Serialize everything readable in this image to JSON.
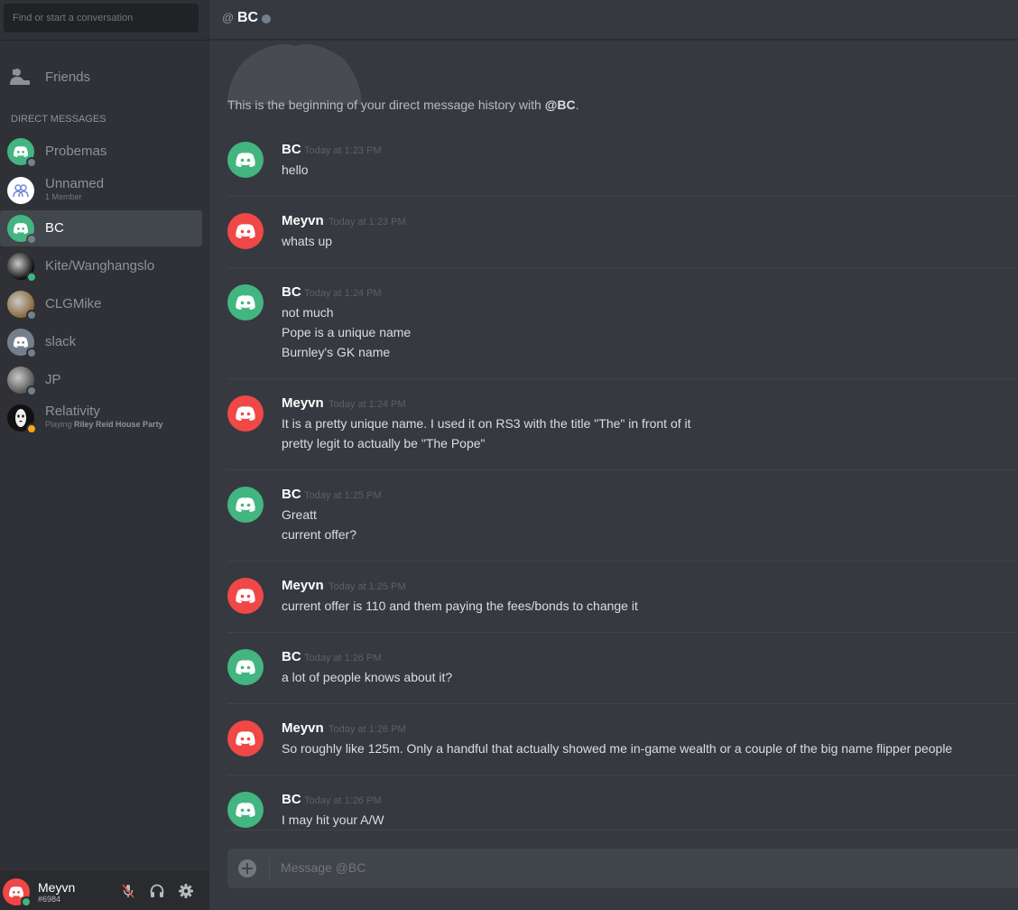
{
  "colors": {
    "sidebar_bg": "#2f3136",
    "main_bg": "#36393f",
    "discord_green": "#43b581",
    "discord_red": "#f04747",
    "discord_gray": "#747f8d",
    "status_online": "#43b581",
    "status_idle": "#faa61a",
    "status_offline": "#747f8d"
  },
  "search": {
    "placeholder": "Find or start a conversation"
  },
  "sidebar": {
    "friends_label": "Friends",
    "dm_header": "DIRECT MESSAGES",
    "dms": [
      {
        "name": "Probemas",
        "sub": "",
        "avatar": "discord-green",
        "status": "offline"
      },
      {
        "name": "Unnamed",
        "sub": "1 Member",
        "avatar": "group",
        "status": ""
      },
      {
        "name": "BC",
        "sub": "",
        "avatar": "discord-green",
        "status": "offline",
        "active": true
      },
      {
        "name": "Kite/Wanghangslo",
        "sub": "",
        "avatar": "photo",
        "status": "online"
      },
      {
        "name": "CLGMike",
        "sub": "",
        "avatar": "photo",
        "status": "offline"
      },
      {
        "name": "slack",
        "sub": "",
        "avatar": "discord-gray",
        "status": "offline"
      },
      {
        "name": "JP",
        "sub": "",
        "avatar": "photo",
        "status": "offline"
      },
      {
        "name": "Relativity",
        "sub_prefix": "Playing ",
        "sub_game": "Riley Reid House Party",
        "avatar": "photo",
        "status": "idle"
      }
    ]
  },
  "user_panel": {
    "name": "Meyvn",
    "tag": "#6984",
    "status": "online"
  },
  "channel": {
    "at": "@",
    "name": "BC",
    "status": "offline"
  },
  "history": {
    "prefix": "This is the beginning of your direct message history with ",
    "handle": "@BC",
    "suffix": "."
  },
  "messages": [
    {
      "author": "BC",
      "time": "Today at 1:23 PM",
      "avatar": "green",
      "lines": [
        "hello"
      ]
    },
    {
      "author": "Meyvn",
      "time": "Today at 1:23 PM",
      "avatar": "red",
      "lines": [
        "whats up"
      ]
    },
    {
      "author": "BC",
      "time": "Today at 1:24 PM",
      "avatar": "green",
      "lines": [
        "not much",
        "Pope is a unique name",
        "Burnley's GK name"
      ]
    },
    {
      "author": "Meyvn",
      "time": "Today at 1:24 PM",
      "avatar": "red",
      "lines": [
        "It is a pretty unique name. I used it on RS3 with the title \"The\" in front of it",
        "pretty legit to actually be \"The Pope\""
      ]
    },
    {
      "author": "BC",
      "time": "Today at 1:25 PM",
      "avatar": "green",
      "lines": [
        "Greatt",
        "current offer?"
      ]
    },
    {
      "author": "Meyvn",
      "time": "Today at 1:25 PM",
      "avatar": "red",
      "lines": [
        "current offer is 110 and them paying the fees/bonds to change it"
      ]
    },
    {
      "author": "BC",
      "time": "Today at 1:26 PM",
      "avatar": "green",
      "lines": [
        "a lot of people knows about it?"
      ]
    },
    {
      "author": "Meyvn",
      "time": "Today at 1:26 PM",
      "avatar": "red",
      "lines": [
        "So roughly like 125m. Only a handful that actually showed me in-game wealth or a couple of the big name flipper people"
      ]
    },
    {
      "author": "BC",
      "time": "Today at 1:26 PM",
      "avatar": "green",
      "lines": [
        "I may hit your A/W"
      ]
    }
  ],
  "composer": {
    "placeholder": "Message @BC"
  }
}
